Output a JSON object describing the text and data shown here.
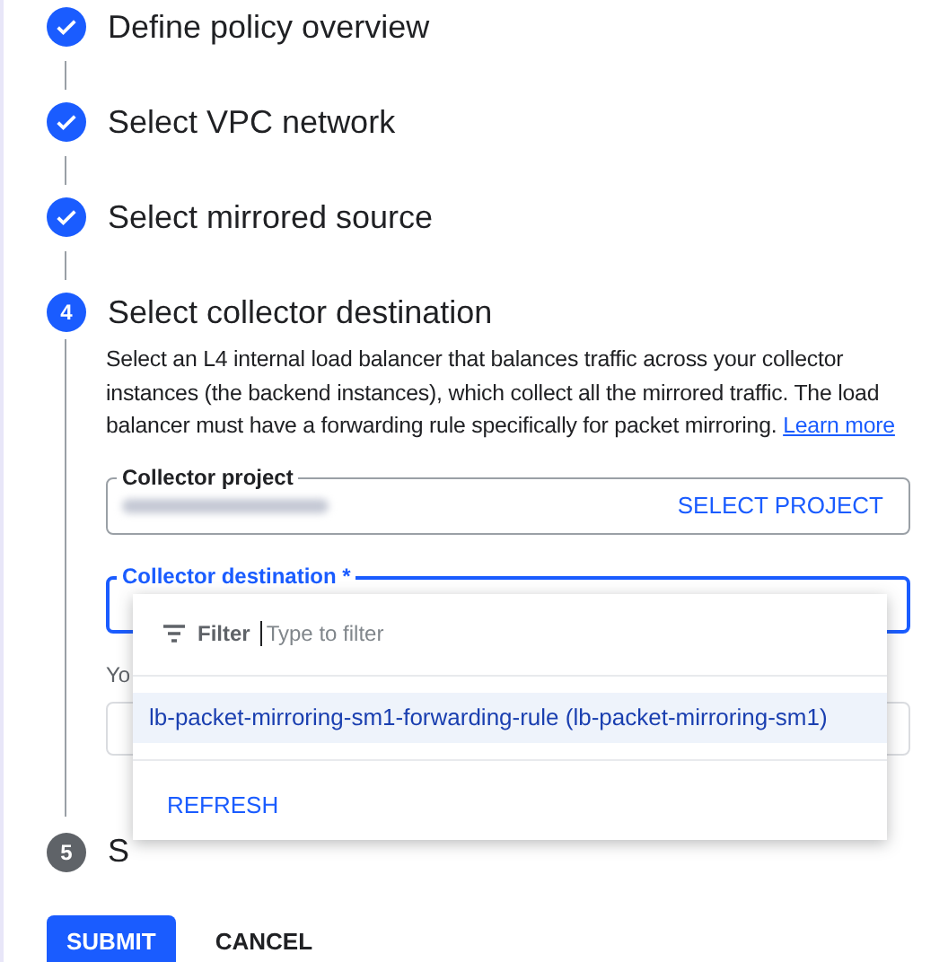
{
  "steps": [
    {
      "title": "Define policy overview",
      "completed": true,
      "active": false
    },
    {
      "title": "Select VPC network",
      "completed": true,
      "active": false
    },
    {
      "title": "Select mirrored source",
      "completed": true,
      "active": false
    },
    {
      "number": "4",
      "title": "Select collector destination",
      "completed": false,
      "active": true
    },
    {
      "number": "5",
      "title": "S",
      "completed": false,
      "active": false
    }
  ],
  "active_step": {
    "description": "Select an L4 internal load balancer that balances traffic across your collector instances (the backend instances), which collect all the mirrored traffic. The load balancer must have a forwarding rule specifically for packet mirroring.",
    "link": "Learn more",
    "collector_project": {
      "label": "Collector project",
      "action": "SELECT PROJECT"
    },
    "collector_destination": {
      "label": "Collector destination *",
      "focused": true
    },
    "hint": "Yo",
    "dropdown": {
      "filter_label": "Filter",
      "filter_placeholder": "Type to filter",
      "options": [
        {
          "label": "lb-packet-mirroring-sm1-forwarding-rule (lb-packet-mirroring-sm1)",
          "selected": true
        }
      ],
      "refresh": "REFRESH"
    }
  },
  "buttons": [
    {
      "label": "SUBMIT",
      "kind": "primary"
    },
    {
      "label": "CANCEL",
      "kind": "text"
    }
  ]
}
